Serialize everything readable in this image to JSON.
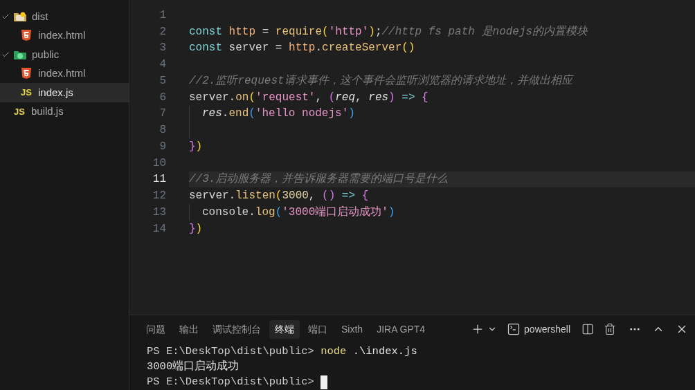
{
  "explorer": {
    "items": [
      {
        "name": "dist",
        "kind": "folder",
        "expanded": true,
        "selected": false,
        "children": [
          {
            "name": "index.html",
            "kind": "html",
            "selected": false
          }
        ]
      },
      {
        "name": "public",
        "kind": "folder-public",
        "expanded": true,
        "selected": false,
        "children": [
          {
            "name": "index.html",
            "kind": "html",
            "selected": false
          },
          {
            "name": "index.js",
            "kind": "js",
            "badge": "JS",
            "selected": true
          }
        ]
      },
      {
        "name": "build.js",
        "kind": "js",
        "badge": "JS",
        "selected": false
      }
    ]
  },
  "editor": {
    "lines": [
      {
        "number": "1",
        "current": false,
        "guide": false
      },
      {
        "number": "2",
        "current": false,
        "guide": false,
        "tokens": [
          {
            "text": "const",
            "kind": "keyword"
          },
          {
            "text": " http",
            "kind": "variable"
          },
          {
            "text": " = ",
            "kind": "plain"
          },
          {
            "text": "require",
            "kind": "function"
          },
          {
            "text": "(",
            "kind": "paren1"
          },
          {
            "text": "'http'",
            "kind": "string"
          },
          {
            "text": ")",
            "kind": "paren1"
          },
          {
            "text": ";",
            "kind": "plain"
          },
          {
            "text": "//http fs path 是nodejs的内置模块",
            "kind": "comment"
          }
        ]
      },
      {
        "number": "3",
        "current": false,
        "guide": false,
        "tokens": [
          {
            "text": "const",
            "kind": "keyword"
          },
          {
            "text": " server = ",
            "kind": "plain"
          },
          {
            "text": "http",
            "kind": "variable"
          },
          {
            "text": ".",
            "kind": "plain"
          },
          {
            "text": "createServer",
            "kind": "function"
          },
          {
            "text": "()",
            "kind": "paren1"
          }
        ]
      },
      {
        "number": "4",
        "current": false,
        "guide": false
      },
      {
        "number": "5",
        "current": false,
        "guide": false,
        "tokens": [
          {
            "text": "//2.监听request请求事件，这个事件会监听浏览器的请求地址，并做出相应",
            "kind": "comment"
          }
        ]
      },
      {
        "number": "6",
        "current": false,
        "guide": false,
        "tokens": [
          {
            "text": "server.",
            "kind": "plain"
          },
          {
            "text": "on",
            "kind": "function"
          },
          {
            "text": "(",
            "kind": "paren1"
          },
          {
            "text": "'request'",
            "kind": "string"
          },
          {
            "text": ", ",
            "kind": "plain"
          },
          {
            "text": "(",
            "kind": "paren2"
          },
          {
            "text": "req",
            "kind": "param"
          },
          {
            "text": ", ",
            "kind": "plain"
          },
          {
            "text": "res",
            "kind": "param"
          },
          {
            "text": ")",
            "kind": "paren2"
          },
          {
            "text": " => ",
            "kind": "keyword"
          },
          {
            "text": "{",
            "kind": "paren2"
          }
        ]
      },
      {
        "number": "7",
        "current": false,
        "guide": true,
        "tokens": [
          {
            "text": "res",
            "kind": "param"
          },
          {
            "text": ".",
            "kind": "plain"
          },
          {
            "text": "end",
            "kind": "function"
          },
          {
            "text": "(",
            "kind": "paren3"
          },
          {
            "text": "'hello nodejs'",
            "kind": "string"
          },
          {
            "text": ")",
            "kind": "paren3"
          }
        ]
      },
      {
        "number": "8",
        "current": false,
        "guide": true
      },
      {
        "number": "9",
        "current": false,
        "guide": false,
        "tokens": [
          {
            "text": "}",
            "kind": "paren2"
          },
          {
            "text": ")",
            "kind": "paren1"
          }
        ]
      },
      {
        "number": "10",
        "current": false,
        "guide": false
      },
      {
        "number": "11",
        "current": true,
        "guide": false,
        "tokens": [
          {
            "text": "//3.启动服务器，并告诉服务器需要的端口号是什么",
            "kind": "comment"
          }
        ]
      },
      {
        "number": "12",
        "current": false,
        "guide": false,
        "tokens": [
          {
            "text": "server.",
            "kind": "plain"
          },
          {
            "text": "listen",
            "kind": "function"
          },
          {
            "text": "(",
            "kind": "paren1"
          },
          {
            "text": "3000",
            "kind": "number"
          },
          {
            "text": ", ",
            "kind": "plain"
          },
          {
            "text": "()",
            "kind": "paren2"
          },
          {
            "text": " => ",
            "kind": "keyword"
          },
          {
            "text": "{",
            "kind": "paren2"
          }
        ]
      },
      {
        "number": "13",
        "current": false,
        "guide": true,
        "tokens": [
          {
            "text": "console.",
            "kind": "plain"
          },
          {
            "text": "log",
            "kind": "function"
          },
          {
            "text": "(",
            "kind": "paren3"
          },
          {
            "text": "'3000端口启动成功'",
            "kind": "string"
          },
          {
            "text": ")",
            "kind": "paren3"
          }
        ]
      },
      {
        "number": "14",
        "current": false,
        "guide": false,
        "tokens": [
          {
            "text": "}",
            "kind": "paren2"
          },
          {
            "text": ")",
            "kind": "paren1"
          }
        ]
      }
    ]
  },
  "panel": {
    "tabs": [
      {
        "label": "问题",
        "selected": false
      },
      {
        "label": "输出",
        "selected": false
      },
      {
        "label": "调试控制台",
        "selected": false
      },
      {
        "label": "终端",
        "selected": true
      },
      {
        "label": "端口",
        "selected": false
      },
      {
        "label": "Sixth",
        "selected": false
      },
      {
        "label": "JIRA GPT4",
        "selected": false
      }
    ],
    "shell": "powershell",
    "terminal": [
      [
        {
          "text": "PS E:\\DeskTop\\dist\\public> ",
          "kind": "prompt"
        },
        {
          "text": "node",
          "kind": "command"
        },
        {
          "text": " .\\index.js",
          "kind": "plain"
        }
      ],
      [
        {
          "text": "3000端口启动成功",
          "kind": "plain"
        }
      ],
      [
        {
          "text": "PS E:\\DeskTop\\dist\\public> ",
          "kind": "prompt"
        },
        {
          "kind": "cursor"
        }
      ]
    ]
  }
}
